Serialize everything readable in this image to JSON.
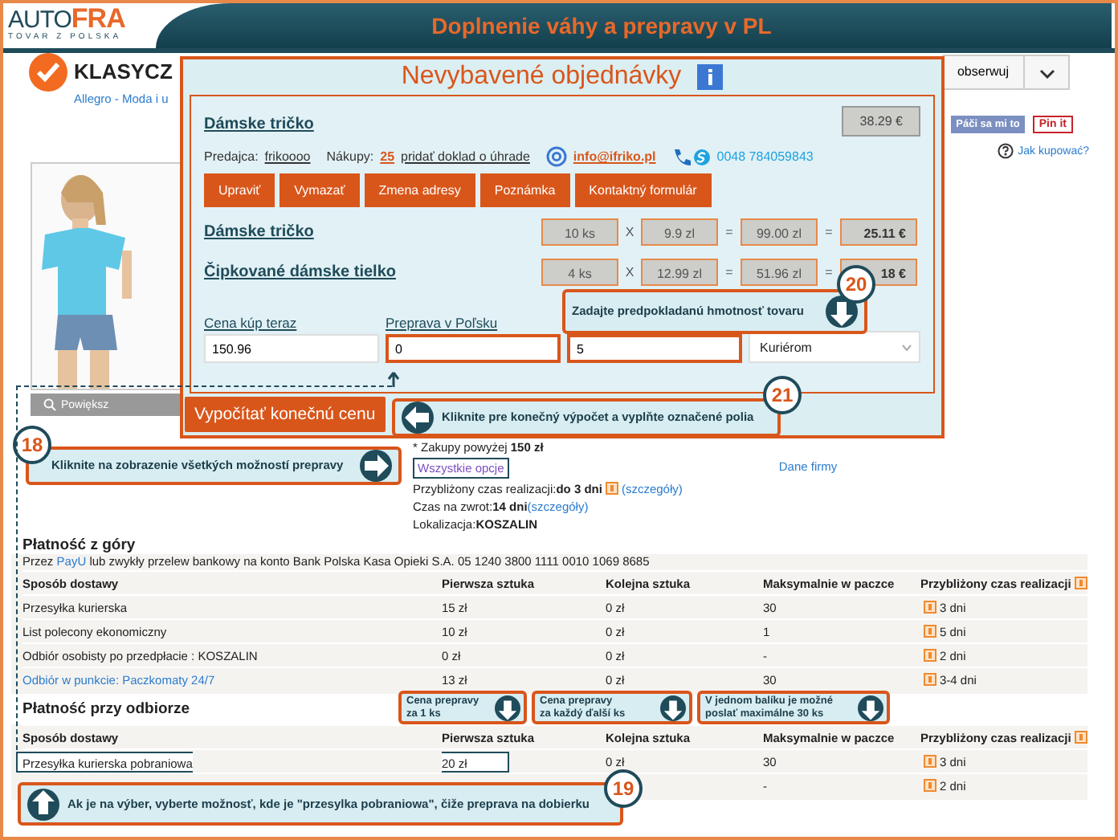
{
  "banner": {
    "logo_main": "AUTO",
    "logo_accent": "FRA",
    "logo_tagline": "TOVAR Z POLSKA",
    "title": "Doplnenie váhy a prepravy v PL"
  },
  "page": {
    "heading": "KLASYCZ",
    "breadcrumb": "Allegro - Moda i u",
    "watch_button": "obserwuj",
    "like_button": "Páči sa mi to",
    "pin_button": "Pin it",
    "how_to_buy": "Jak kupować?",
    "zoom_button": "Powiększ",
    "shipping": {
      "free_note": "* Zakupy powyżej **150 zł**",
      "all_options": "Wszystkie opcje",
      "company": "Dane firmy",
      "lines": [
        {
          "label": "Przybliżony czas realizacji:",
          "value": "do 3 dni",
          "help": true,
          "link": "(szczegóły)"
        },
        {
          "label": "Czas na zwrot:",
          "value": "14 dni",
          "help": false,
          "link": "(szczegóły)"
        },
        {
          "label": "Lokalizacja:",
          "value": "KOSZALIN",
          "help": false
        }
      ]
    },
    "sections": [
      {
        "title": "Płatność z góry",
        "note_prefix": "Przez",
        "note_link": "PayU",
        "note_rest": "lub zwykły przelew bankowy na konto Bank Polska Kasa Opieki S.A. 05 1240 3800 1111 0010 1069 8685",
        "columns": [
          "Sposób dostawy",
          "Pierwsza sztuka",
          "Kolejna sztuka",
          "Maksymalnie w paczce",
          "Przybliżony czas realizacji"
        ],
        "rows": [
          {
            "method": "Przesyłka kurierska",
            "first": "15 zł",
            "next": "0 zł",
            "max": "30",
            "time": "3 dni",
            "link": false,
            "highlighted": false
          },
          {
            "method": "List polecony ekonomiczny",
            "first": "10 zł",
            "next": "0 zł",
            "max": "1",
            "time": "5 dni",
            "link": false,
            "highlighted": false
          },
          {
            "method": "Odbiór osobisty po przedpłacie : KOSZALIN",
            "first": "0 zł",
            "next": "0 zł",
            "max": "-",
            "time": "2 dni",
            "link": false,
            "highlighted": false
          },
          {
            "method": "Odbiór w punkcie: Paczkomaty 24/7",
            "first": "13 zł",
            "next": "0 zł",
            "max": "30",
            "time": "3-4 dni",
            "link": true,
            "highlighted": false
          }
        ]
      },
      {
        "title": "Płatność przy odbiorze",
        "columns": [
          "Sposób dostawy",
          "Pierwsza sztuka",
          "Kolejna sztuka",
          "Maksymalnie w paczce",
          "Przybliżony czas realizacji"
        ],
        "rows": [
          {
            "method": "Przesyłka kurierska pobraniowa",
            "first": "20 zł",
            "next": "0 zł",
            "max": "30",
            "time": "3 dni",
            "link": false,
            "highlighted": true
          },
          {
            "max": "-",
            "time": "2 dni",
            "highlighted": false
          }
        ]
      }
    ]
  },
  "modal": {
    "title": "Nevybavené objednávky",
    "order": {
      "title": "Dámske tričko",
      "price": "38.29 €",
      "seller_label": "Predajca:",
      "seller": "frikoooo",
      "purchases_label": "Nákupy:",
      "purchases": "25",
      "add_proof": "pridať doklad o úhrade",
      "email": "info@ifriko.pl",
      "phone": "0048 784059843",
      "actions": [
        "Upraviť",
        "Vymazať",
        "Zmena adresy",
        "Poznámka",
        "Kontaktný formulár"
      ]
    },
    "items": [
      {
        "name": "Dámske tričko",
        "qty": "10 ks",
        "times": "X",
        "unit_price": "9.9 zl",
        "equals": "=",
        "total": "99.00 zl",
        "equals2": "=",
        "eur": "25.11 €"
      },
      {
        "name": "Čipkované dámske tielko",
        "qty": "4 ks",
        "times": "X",
        "unit_price": "12.99 zl",
        "equals": "=",
        "total": "51.96 zl",
        "equals2": "=",
        "eur": "18 €"
      }
    ],
    "form": {
      "price_label": "Cena kúp teraz",
      "price": "150.96",
      "shipping_label": "Preprava v Poľsku",
      "shipping": "0",
      "weight": "5",
      "method": "Kuriérom"
    },
    "calc_button": "Vypočítať konečnú cenu"
  },
  "callouts": [
    {
      "number": "18",
      "lines": [
        "Kliknite na zobrazenie všetkých možností prepravy"
      ],
      "kind": "right"
    },
    {
      "number": "20",
      "lines": [
        "Zadajte predpokladanú hmotnosť tovaru"
      ],
      "kind": "down"
    },
    {
      "number": "21",
      "lines": [
        "Kliknite pre konečný výpočet a vyplňte označené polia"
      ],
      "kind": "left"
    },
    {
      "number": "19",
      "lines": [
        "Ak je na výber, vyberte možnosť, kde je \"przesylka pobraniowa\", čiže preprava na dobierku"
      ],
      "kind": "up"
    },
    {
      "lines": [
        "Cena prepravy",
        "za 1 ks"
      ],
      "kind": "down"
    },
    {
      "lines": [
        "Cena prepravy",
        "za každý ďalší ks"
      ],
      "kind": "down"
    },
    {
      "lines": [
        "V jednom balíku je možné",
        "poslať maximálne 30 ks"
      ],
      "kind": "down"
    }
  ]
}
